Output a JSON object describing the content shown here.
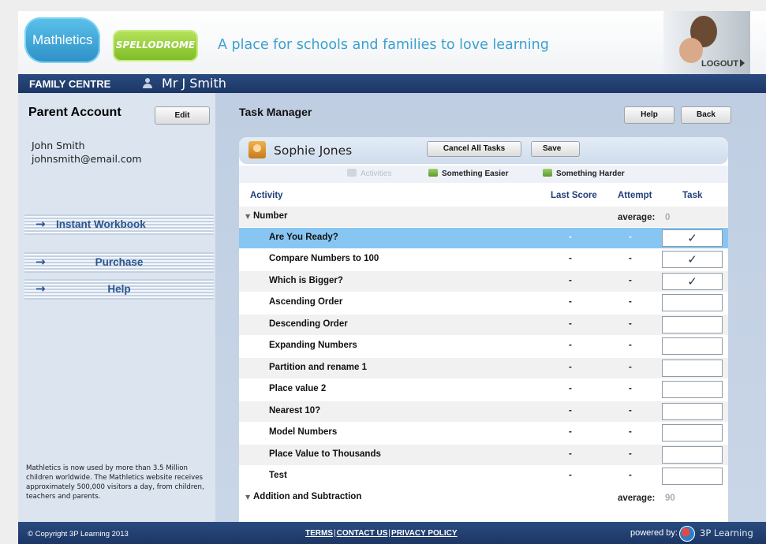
{
  "header": {
    "mathletics_logo": "Mathletics",
    "spellodrome_logo": "SPELLODROME",
    "tagline": "A place for schools and families to love learning",
    "logout_label": "LOGOUT"
  },
  "family_bar": {
    "title": "FAMILY CENTRE",
    "user_name": "Mr J Smith"
  },
  "sidebar": {
    "title": "Parent Account",
    "edit_label": "Edit",
    "account_name": "John Smith",
    "account_email": "johnsmith@email.com",
    "nav": [
      {
        "label": "Instant Workbook"
      },
      {
        "label": "Purchase"
      },
      {
        "label": "Help"
      }
    ],
    "blurb": "Mathletics is now used by more than 3.5 Million children worldwide. The Mathletics website receives approximately 500,000 visitors a day, from children, teachers and parents."
  },
  "main": {
    "title": "Task Manager",
    "help_label": "Help",
    "back_label": "Back",
    "student_name": "Sophie Jones",
    "cancel_all_label": "Cancel All Tasks",
    "save_label": "Save",
    "options": {
      "activities": "Activities",
      "easier": "Something Easier",
      "harder": "Something Harder"
    },
    "columns": {
      "activity": "Activity",
      "last_score": "Last Score",
      "attempt": "Attempt",
      "task": "Task"
    },
    "groups": [
      {
        "name": "Number",
        "average_label": "average:",
        "average_value": "0"
      },
      {
        "name": "Addition and Subtraction",
        "average_label": "average:",
        "average_value": "90"
      }
    ],
    "activities": [
      {
        "name": "Are You Ready?",
        "last_score": "-",
        "attempt": "-",
        "task": "✓"
      },
      {
        "name": "Compare Numbers to 100",
        "last_score": "-",
        "attempt": "-",
        "task": "✓"
      },
      {
        "name": "Which is Bigger?",
        "last_score": "-",
        "attempt": "-",
        "task": "✓"
      },
      {
        "name": "Ascending Order",
        "last_score": "-",
        "attempt": "-",
        "task": ""
      },
      {
        "name": "Descending Order",
        "last_score": "-",
        "attempt": "-",
        "task": ""
      },
      {
        "name": "Expanding Numbers",
        "last_score": "-",
        "attempt": "-",
        "task": ""
      },
      {
        "name": "Partition and rename 1",
        "last_score": "-",
        "attempt": "-",
        "task": ""
      },
      {
        "name": "Place value 2",
        "last_score": "-",
        "attempt": "-",
        "task": ""
      },
      {
        "name": "Nearest 10?",
        "last_score": "-",
        "attempt": "-",
        "task": ""
      },
      {
        "name": "Model Numbers",
        "last_score": "-",
        "attempt": "-",
        "task": ""
      },
      {
        "name": "Place Value to Thousands",
        "last_score": "-",
        "attempt": "-",
        "task": ""
      },
      {
        "name": "Test",
        "last_score": "-",
        "attempt": "-",
        "task": ""
      }
    ]
  },
  "footer": {
    "copyright": "© Copyright 3P Learning 2013",
    "terms": "TERMS",
    "contact": "CONTACT US",
    "privacy": "PRIVACY POLICY",
    "powered_by": "powered by:",
    "company": "3P Learning"
  },
  "colors": {
    "header_bar": "#1f3a6b",
    "page_bg": "#7e9fc6",
    "selected_row": "#87c6f2",
    "accent_link": "#2a5590"
  },
  "icons": [
    "user-icon",
    "arrow-right-icon",
    "gift-icon",
    "triangle-down-icon",
    "checkmark-icon",
    "logout-arrow-icon",
    "3p-learning-logo"
  ]
}
